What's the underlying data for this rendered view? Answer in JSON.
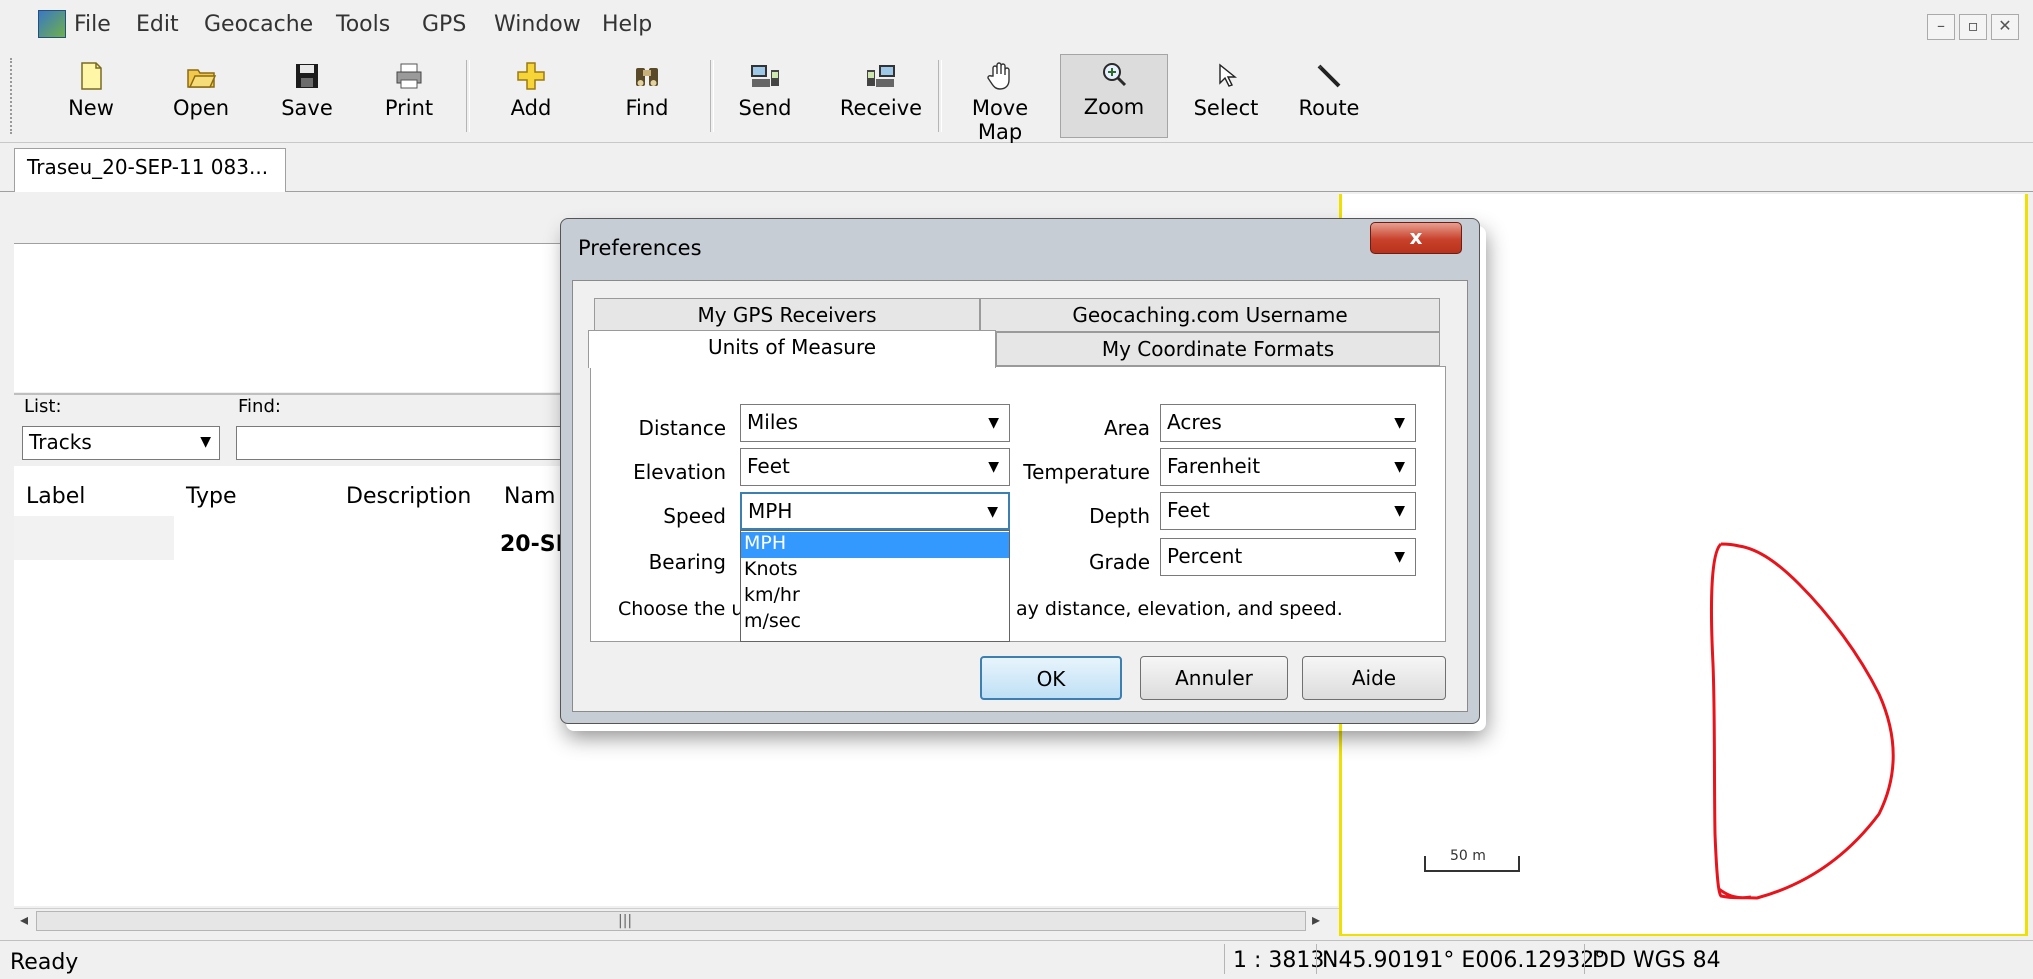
{
  "menubar": {
    "items": [
      "File",
      "Edit",
      "Geocache",
      "Tools",
      "GPS",
      "Window",
      "Help"
    ]
  },
  "window_controls": [
    "–",
    "▫",
    "✕"
  ],
  "toolbar": {
    "buttons": [
      {
        "label": "New",
        "icon": "new-document-icon"
      },
      {
        "label": "Open",
        "icon": "open-folder-icon"
      },
      {
        "label": "Save",
        "icon": "save-disk-icon"
      },
      {
        "label": "Print",
        "icon": "printer-icon"
      },
      {
        "label": "Add",
        "icon": "add-plus-icon"
      },
      {
        "label": "Find",
        "icon": "binoculars-icon"
      },
      {
        "label": "Send",
        "icon": "send-to-gps-icon"
      },
      {
        "label": "Receive",
        "icon": "receive-from-gps-icon"
      },
      {
        "label": "Move Map",
        "icon": "hand-icon"
      },
      {
        "label": "Zoom",
        "icon": "magnifier-icon"
      },
      {
        "label": "Select",
        "icon": "arrow-cursor-icon"
      },
      {
        "label": "Route",
        "icon": "pencil-icon"
      }
    ],
    "active": "Zoom"
  },
  "document_tab": "Traseu_20-SEP-11 083...",
  "list_panel": {
    "list_label": "List:",
    "find_label": "Find:",
    "list_value": "Tracks",
    "columns": [
      "Label",
      "Type",
      "Description",
      "Nam"
    ],
    "rows": [
      {
        "label": "",
        "type": "",
        "description": "",
        "name": "20-SE"
      }
    ]
  },
  "map": {
    "scale_label": "50 m",
    "track_color": "#e8141b"
  },
  "statusbar": {
    "status": "Ready",
    "scale": "1 : 3813",
    "coords": "N45.90191° E006.12932°",
    "datum": "DD WGS 84"
  },
  "dialog": {
    "title": "Preferences",
    "close_label": "x",
    "tabs_back": [
      "My GPS Receivers",
      "Geocaching.com Username"
    ],
    "tabs_front": [
      "Units of Measure",
      "My Coordinate Formats"
    ],
    "active_tab": "Units of Measure",
    "fields": {
      "distance": {
        "label": "Distance",
        "value": "Miles"
      },
      "elevation": {
        "label": "Elevation",
        "value": "Feet"
      },
      "speed": {
        "label": "Speed",
        "value": "MPH"
      },
      "bearing": {
        "label": "Bearing",
        "value": ""
      },
      "area": {
        "label": "Area",
        "value": "Acres"
      },
      "temperature": {
        "label": "Temperature",
        "value": "Farenheit"
      },
      "depth": {
        "label": "Depth",
        "value": "Feet"
      },
      "grade": {
        "label": "Grade",
        "value": "Percent"
      }
    },
    "speed_options": [
      "MPH",
      "Knots",
      "km/hr",
      "m/sec"
    ],
    "help_text_left": "Choose the u",
    "help_text_right": "ay distance, elevation, and speed.",
    "buttons": {
      "ok": "OK",
      "cancel": "Annuler",
      "help": "Aide"
    }
  }
}
